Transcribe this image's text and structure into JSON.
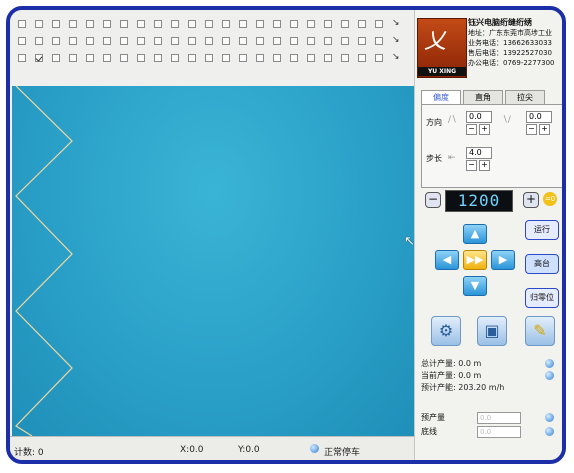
{
  "company": {
    "logo_text": "YU XING",
    "name": "钰兴电脑绗缝绗绣",
    "address": "地址：广东东莞市高埗工业",
    "phone1": "业务电话：13662633033",
    "phone2": "售后电话：13922527030",
    "phone3": "办公电话：0769-2277300"
  },
  "tabs": [
    "偏度",
    "直角",
    "拉尖"
  ],
  "params": {
    "direction_label": "方向",
    "direction_value_1": "0.0",
    "direction_value_2": "0.0",
    "step_label": "步长",
    "step_value": "4.0"
  },
  "speed": {
    "display": "1200",
    "zero_label": "=0"
  },
  "buttons": {
    "run": "运行",
    "raise": "高台",
    "reset": "归零位"
  },
  "stats": {
    "total_output": "总计产量: 0.0 m",
    "current_output": "当前产量: 0.0 m",
    "predicted_rate": "预计产能: 203.20 m/h"
  },
  "preset": {
    "preset_label": "预产量",
    "bottom_thread_label": "底线",
    "preset_value": "0.0",
    "bottom_value": "0.0"
  },
  "statusbar": {
    "count": "计数: 0",
    "x": "X:0.0",
    "y": "Y:0.0",
    "status": "正常停车"
  },
  "colors": {
    "frame_border": "#1d2fa8",
    "canvas": "#2aa0c8",
    "display_text": "#6fd4ff",
    "arrow_blue": "#2a94d8",
    "arrow_center": "#f0b20e"
  },
  "icons": {
    "settings": "gear-icon",
    "card": "memory-card-icon",
    "edit": "pencil-icon",
    "cursor": "mouse-pointer-icon"
  }
}
